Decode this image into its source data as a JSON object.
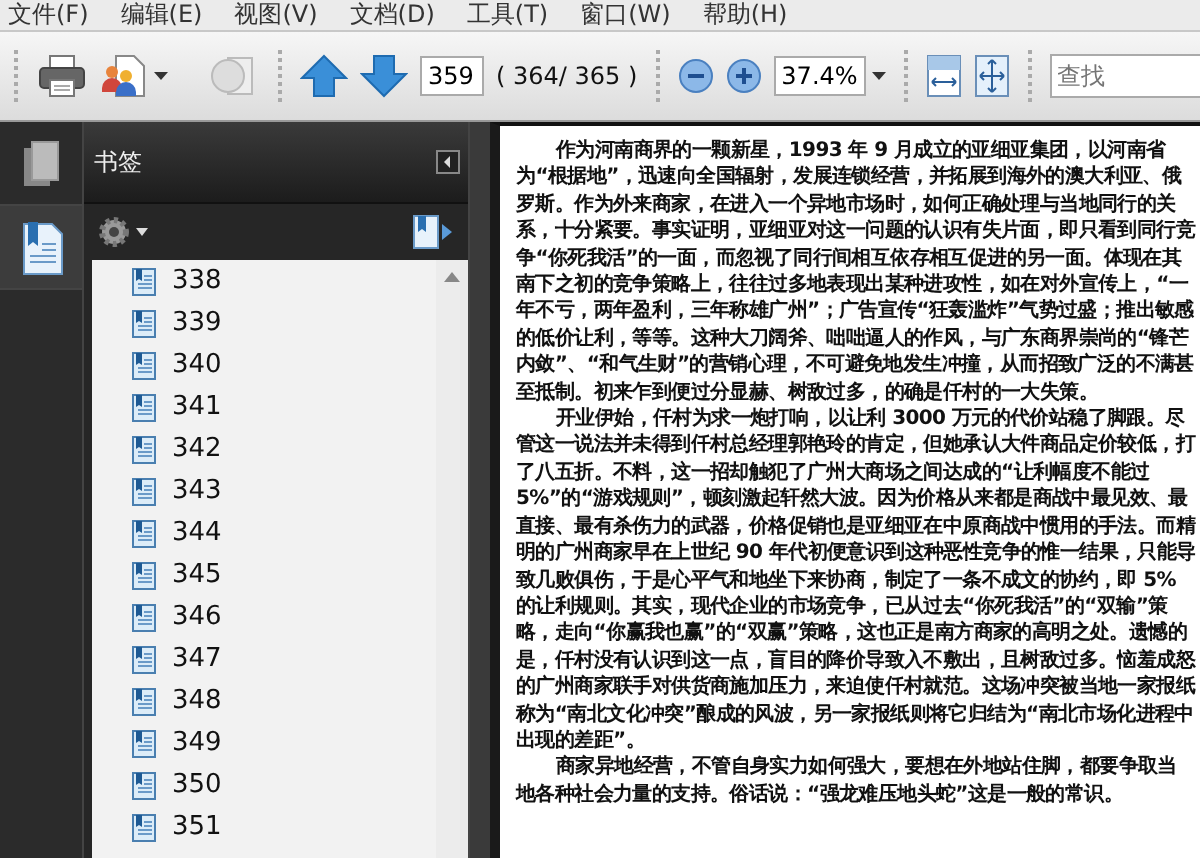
{
  "menu": [
    {
      "label": "文件(F)"
    },
    {
      "label": "编辑(E)"
    },
    {
      "label": "视图(V)"
    },
    {
      "label": "文档(D)"
    },
    {
      "label": "工具(T)"
    },
    {
      "label": "窗口(W)"
    },
    {
      "label": "帮助(H)"
    }
  ],
  "toolbar": {
    "page_number": "359",
    "page_count": "( 364/ 365 )",
    "zoom": "37.4%",
    "search": {
      "placeholder": "查找"
    }
  },
  "nav_tabs": [
    {
      "kind": "pages",
      "selected": false
    },
    {
      "kind": "bookmarks",
      "selected": true
    }
  ],
  "bookmarks": {
    "title": "书签",
    "items": [
      "338",
      "339",
      "340",
      "341",
      "342",
      "343",
      "344",
      "345",
      "346",
      "347",
      "348",
      "349",
      "350",
      "351"
    ]
  },
  "document": {
    "paragraphs": [
      "作为河南商界的一颗新星，1993 年 9 月成立的亚细亚集团，以河南省为“根据地”，迅速向全国辐射，发展连锁经营，并拓展到海外的澳大利亚、俄罗斯。作为外来商家，在进入一个异地市场时，如何正确处理与当地同行的关系，十分紧要。事实证明，亚细亚对这一问题的认识有失片面，即只看到同行竞争“你死我活”的一面，而忽视了同行间相互依存相互促进的另一面。体现在其南下之初的竞争策略上，往往过多地表现出某种进攻性，如在对外宣传上，“一年不亏，两年盈利，三年称雄广州”；广告宣传“狂轰滥炸”气势过盛；推出敏感的低价让利，等等。这种大刀阔斧、咄咄逼人的作风，与广东商界崇尚的“锋芒内敛”、“和气生财”的营销心理，不可避免地发生冲撞，从而招致广泛的不满甚至抵制。初来乍到便过分显赫、树敌过多，的确是仟村的一大失策。",
      "开业伊始，仟村为求一炮打响，以让利 3000 万元的代价站稳了脚跟。尽管这一说法并未得到仟村总经理郭艳玲的肯定，但她承认大件商品定价较低，打了八五折。不料，这一招却触犯了广州大商场之间达成的“让利幅度不能过 5%”的“游戏规则”，顿刻激起轩然大波。因为价格从来都是商战中最见效、最直接、最有杀伤力的武器，价格促销也是亚细亚在中原商战中惯用的手法。而精明的广州商家早在上世纪 90 年代初便意识到这种恶性竞争的惟一结果，只能导致几败俱伤，于是心平气和地坐下来协商，制定了一条不成文的协约，即 5% 的让利规则。其实，现代企业的市场竞争，已从过去“你死我活”的“双输”策略，走向“你赢我也赢”的“双赢”策略，这也正是南方商家的高明之处。遗憾的是，仟村没有认识到这一点，盲目的降价导致入不敷出，且树敌过多。恼羞成怒的广州商家联手对供货商施加压力，来迫使仟村就范。这场冲突被当地一家报纸称为“南北文化冲突”酿成的风波，另一家报纸则将它归结为“南北市场化进程中出现的差距”。",
      "商家异地经营，不管自身实力如何强大，要想在外地站住脚，都要争取当地各种社会力量的支持。俗话说：“强龙难压地头蛇”这是一般的常识。"
    ]
  }
}
